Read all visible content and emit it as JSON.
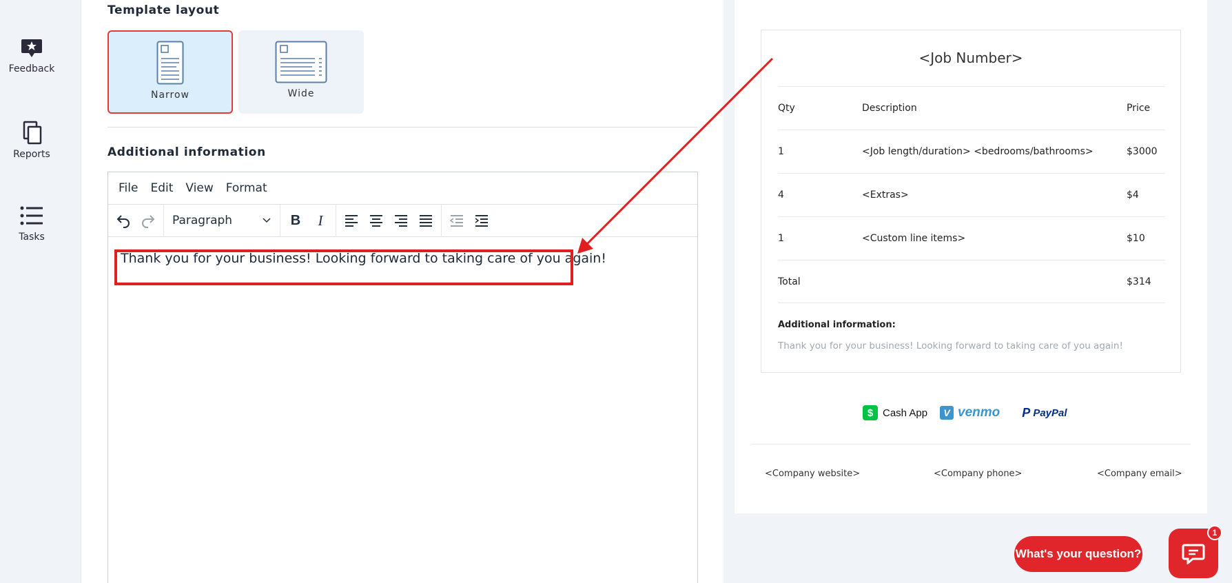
{
  "sidebar": {
    "items": [
      {
        "label": "Feedback",
        "icon": "feedback-icon"
      },
      {
        "label": "Reports",
        "icon": "reports-icon"
      },
      {
        "label": "Tasks",
        "icon": "tasks-icon"
      }
    ]
  },
  "template_layout": {
    "title": "Template layout",
    "options": [
      {
        "label": "Narrow",
        "selected": true
      },
      {
        "label": "Wide",
        "selected": false
      }
    ]
  },
  "additional_info": {
    "title": "Additional information",
    "menu": [
      "File",
      "Edit",
      "View",
      "Format"
    ],
    "block_format": "Paragraph",
    "content": "Thank you for your business! Looking forward to taking care of you again!"
  },
  "preview": {
    "title": "<Job Number>",
    "columns": [
      "Qty",
      "Description",
      "Price"
    ],
    "rows": [
      {
        "qty": "1",
        "description": "<Job length/duration> <bedrooms/bathrooms>",
        "price": "$3000"
      },
      {
        "qty": "4",
        "description": "<Extras>",
        "price": "$4"
      },
      {
        "qty": "1",
        "description": "<Custom line items>",
        "price": "$10"
      }
    ],
    "total_label": "Total",
    "total_value": "$314",
    "additional_label": "Additional information:",
    "additional_text": "Thank you for your business! Looking forward to taking care of you again!",
    "payments": {
      "cashapp": {
        "icon_text": "$",
        "label": "Cash App"
      },
      "venmo": {
        "icon_text": "V",
        "label": "venmo"
      },
      "paypal": {
        "icon_text": "P",
        "label": "PayPal"
      }
    },
    "footer": {
      "website": "<Company website>",
      "phone": "<Company phone>",
      "email": "<Company email>"
    }
  },
  "chat": {
    "prompt": "What's your question?",
    "badge": "1"
  },
  "colors": {
    "accent_red": "#e0262b",
    "selected_bg": "#dbeefb",
    "annotation_red": "#e02020"
  }
}
